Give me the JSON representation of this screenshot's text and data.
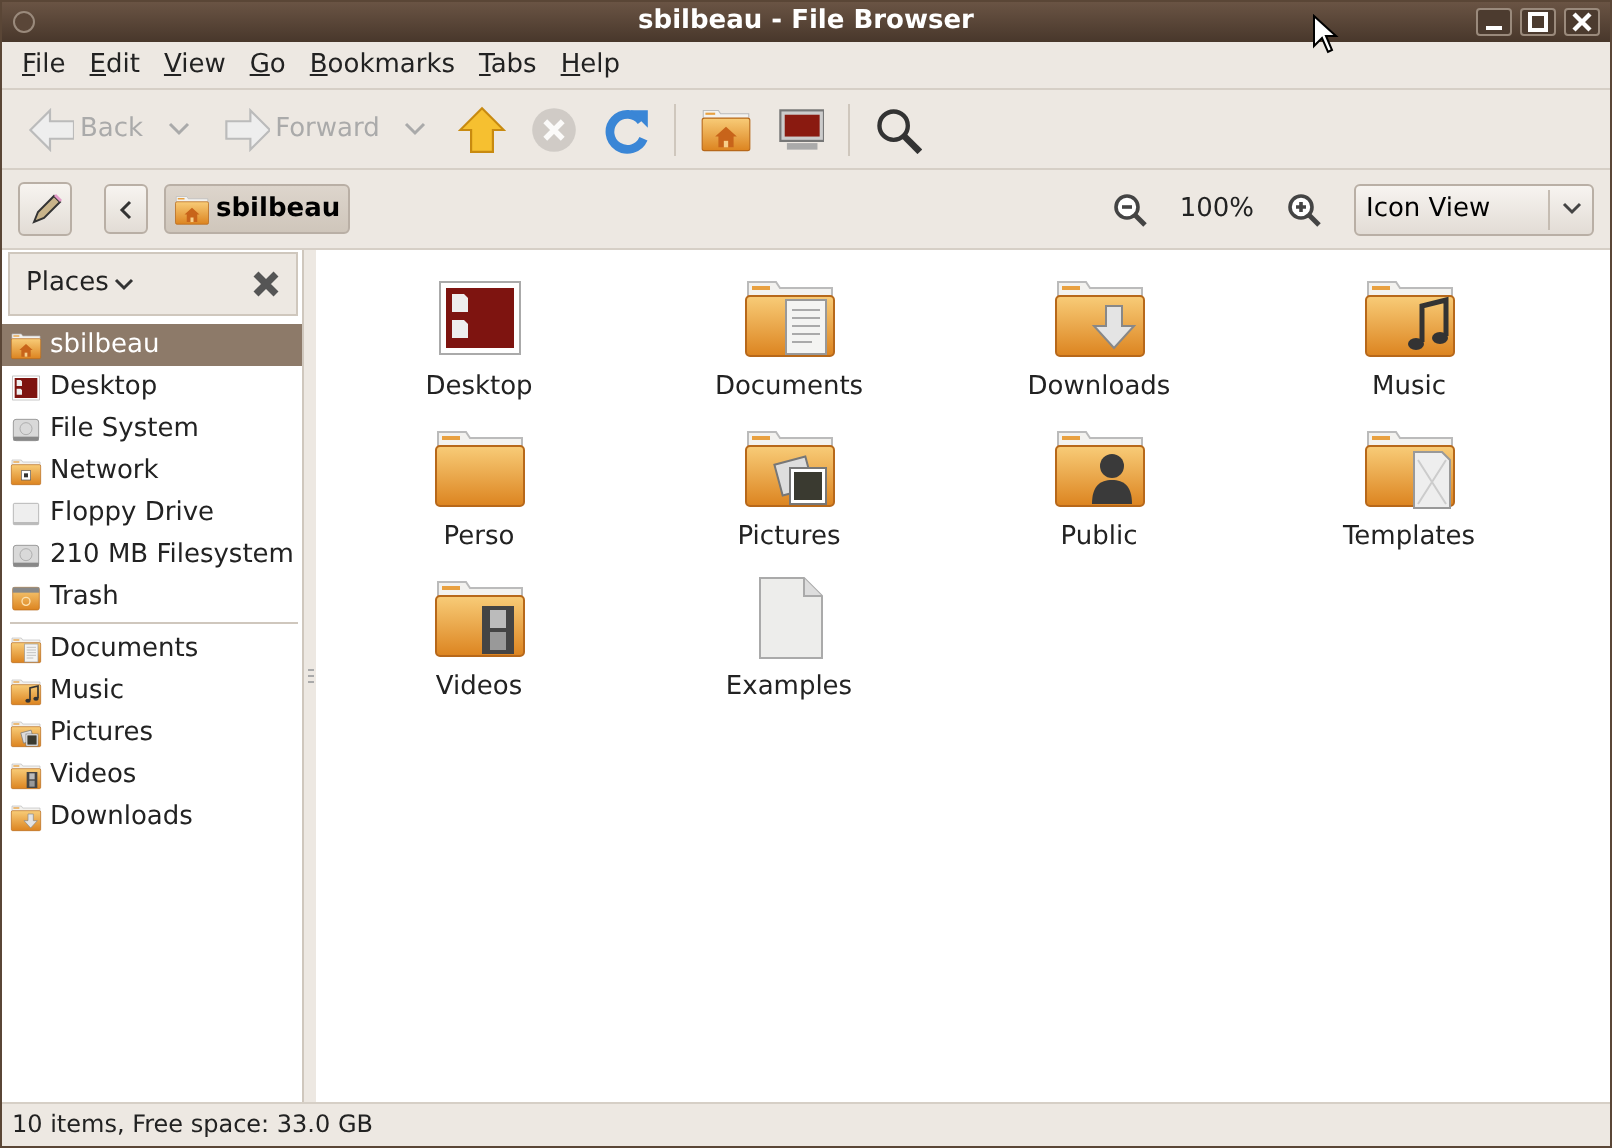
{
  "window": {
    "title": "sbilbeau - File Browser"
  },
  "menu": [
    {
      "label": "File"
    },
    {
      "label": "Edit"
    },
    {
      "label": "View"
    },
    {
      "label": "Go"
    },
    {
      "label": "Bookmarks"
    },
    {
      "label": "Tabs"
    },
    {
      "label": "Help"
    }
  ],
  "toolbar": [
    {
      "kind": "back",
      "label": "Back",
      "disabled": true
    },
    {
      "kind": "forward",
      "label": "Forward",
      "disabled": true
    },
    {
      "kind": "up",
      "disabled": false
    },
    {
      "kind": "stop",
      "disabled": true
    },
    {
      "kind": "reload",
      "disabled": false
    },
    {
      "kind": "separator"
    },
    {
      "kind": "home",
      "disabled": false
    },
    {
      "kind": "computer",
      "disabled": false
    },
    {
      "kind": "separator"
    },
    {
      "kind": "search",
      "disabled": false
    }
  ],
  "location": {
    "path": [
      {
        "label": "sbilbeau",
        "selected": true
      }
    ],
    "zoom": "100%",
    "view": "Icon View"
  },
  "sidebar": {
    "title": "Places",
    "groups": [
      [
        {
          "label": "sbilbeau",
          "kind": "home",
          "selected": true
        },
        {
          "label": "Desktop",
          "kind": "desktop",
          "selected": false
        },
        {
          "label": "File System",
          "kind": "drive",
          "selected": false
        },
        {
          "label": "Network",
          "kind": "network",
          "selected": false
        },
        {
          "label": "Floppy Drive",
          "kind": "floppy",
          "selected": false
        },
        {
          "label": "210 MB Filesystem",
          "kind": "drive",
          "selected": false
        },
        {
          "label": "Trash",
          "kind": "trash",
          "selected": false
        }
      ],
      [
        {
          "label": "Documents",
          "kind": "documents",
          "selected": false
        },
        {
          "label": "Music",
          "kind": "music",
          "selected": false
        },
        {
          "label": "Pictures",
          "kind": "pictures",
          "selected": false
        },
        {
          "label": "Videos",
          "kind": "videos",
          "selected": false
        },
        {
          "label": "Downloads",
          "kind": "downloads",
          "selected": false
        }
      ]
    ]
  },
  "files": [
    {
      "label": "Desktop",
      "kind": "desktop"
    },
    {
      "label": "Documents",
      "kind": "documents"
    },
    {
      "label": "Downloads",
      "kind": "downloads"
    },
    {
      "label": "Music",
      "kind": "music"
    },
    {
      "label": "Perso",
      "kind": "folder"
    },
    {
      "label": "Pictures",
      "kind": "pictures"
    },
    {
      "label": "Public",
      "kind": "public"
    },
    {
      "label": "Templates",
      "kind": "templates"
    },
    {
      "label": "Videos",
      "kind": "videos"
    },
    {
      "label": "Examples",
      "kind": "file"
    }
  ],
  "status_bar": "10 items, Free space: 33.0 GB"
}
